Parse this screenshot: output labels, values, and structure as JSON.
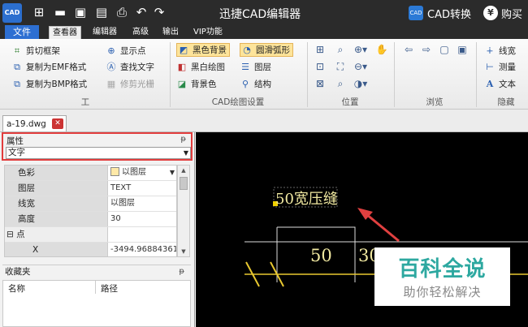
{
  "titlebar": {
    "app_title": "迅捷CAD编辑器",
    "cad_convert": "CAD转换",
    "buy": "购买",
    "logo_text": "CAD"
  },
  "menus": [
    "文件",
    "查看器",
    "编辑器",
    "高级",
    "输出",
    "VIP功能"
  ],
  "active_menu": "查看器",
  "ribbon": {
    "tools": {
      "label": "工具",
      "items": [
        "剪切框架",
        "复制为EMF格式",
        "复制为BMP格式",
        "显示点",
        "查找文字",
        "修剪光栅"
      ]
    },
    "cad_settings": {
      "label": "CAD绘图设置",
      "items": [
        "黑色背景",
        "黑白绘图",
        "背景色",
        "圆滑弧形",
        "图层",
        "结构"
      ]
    },
    "position": {
      "label": "位置"
    },
    "browse": {
      "label": "浏览"
    },
    "hide": {
      "label": "隐藏",
      "items": [
        "线宽",
        "测量",
        "文本"
      ]
    }
  },
  "doc_tab": {
    "name": "a-19.dwg"
  },
  "properties": {
    "title": "属性",
    "selected_type": "文字",
    "rows": [
      {
        "key": "色彩",
        "value": "以图层",
        "swatch": true
      },
      {
        "key": "图层",
        "value": "TEXT"
      },
      {
        "key": "线宽",
        "value": "以图层"
      },
      {
        "key": "高度",
        "value": "30"
      },
      {
        "key": "⊟ 点",
        "value": "",
        "category": true
      },
      {
        "key": "X",
        "value": "-3494.968843611"
      }
    ]
  },
  "favorites": {
    "title": "收藏夹",
    "columns": [
      "名称",
      "路径"
    ]
  },
  "canvas": {
    "label_main": "50宽压缝",
    "dim_1": "50",
    "dim_2": "30"
  },
  "watermark": {
    "title": "百科全说",
    "subtitle": "助你轻松解决"
  },
  "colors": {
    "titlebar": "#2b2b2b",
    "accent_blue": "#2d6fd2",
    "highlight": "#e23d3d",
    "cad_yellow": "#f0e8a0",
    "watermark_teal": "#2da8a0"
  }
}
